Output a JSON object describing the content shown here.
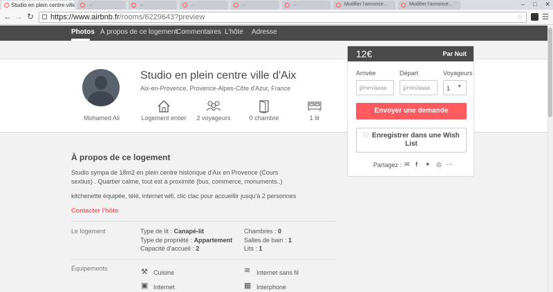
{
  "browser": {
    "active_tab": "Studio en plein centre ville d'Aix",
    "tabs": [
      "...",
      "...",
      "...",
      "...",
      "...",
      "Modifier l'annonce...",
      "Modifier l'annonce..."
    ],
    "url_host": "https://www.airbnb.fr",
    "url_path": "/rooms/6229643?preview"
  },
  "nav": {
    "items": [
      "Photos",
      "À propos de ce logement",
      "Commentaires",
      "L'hôte",
      "Adresse"
    ]
  },
  "listing": {
    "title": "Studio en plein centre ville d'Aix",
    "location": "Aix-en-Provence, Provence-Alpes-Côte d'Azur, France",
    "host_name": "Mohamed Ali",
    "features": [
      "Logement entier",
      "2 voyageurs",
      "0 chambre",
      "1 lit"
    ]
  },
  "booking": {
    "price": "12€",
    "per": "Par Nuit",
    "arrival_label": "Arrivée",
    "departure_label": "Départ",
    "guests_label": "Voyageurs",
    "arrival_placeholder": "jj/mm/aaaa",
    "departure_placeholder": "jj/mm/aaaa",
    "guests_value": "1",
    "request_button": "Envoyer une demande",
    "wishlist_line1": "Enregistrer dans une Wish",
    "wishlist_line2": "List",
    "share_label": "Partagez :",
    "share_more": "···"
  },
  "about": {
    "title": "À propos de ce logement",
    "desc": "Studio sympa de 18m2 en plein centre historique d'Aix en Provence (Cours sextius) . Quartier calme, tout est à proximité (bus, commerce, monuments..)",
    "desc2": "kitchenette équipée, télé, internet wifi, clic clac pour accueillir jusqu'à 2 personnes",
    "contact": "Contacter l'hôte"
  },
  "details": {
    "heading": "Le logement",
    "bed_type_label": "Type de lit :",
    "bed_type": "Canapé-lit",
    "property_label": "Type de propriété :",
    "property": "Appartement",
    "capacity_label": "Capacité d'accueil :",
    "capacity": "2",
    "rooms_label": "Chambres :",
    "rooms": "0",
    "bath_label": "Salles de bain :",
    "bath": "1",
    "beds_label": "Lits :",
    "beds": "1"
  },
  "amenities": {
    "heading": "Équipements",
    "items": [
      "Cuisine",
      "Internet sans fil",
      "Internet",
      "Interphone"
    ]
  },
  "colors": {
    "brand": "#ff5a5f",
    "nav": "#4a4a4a"
  }
}
